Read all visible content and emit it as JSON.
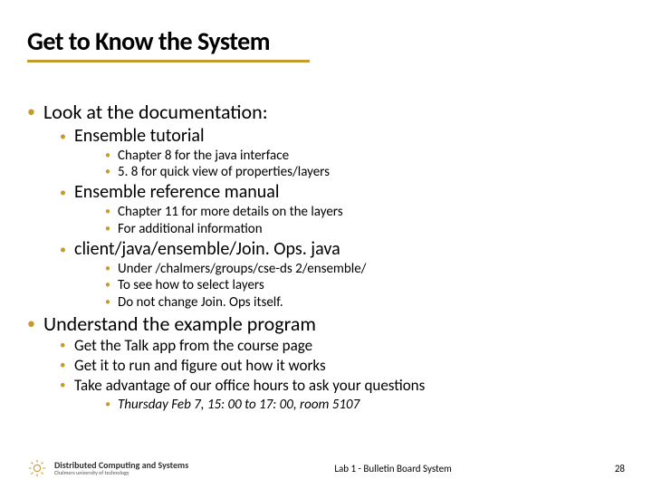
{
  "title": "Get to Know the System",
  "bullets": {
    "l1_doc": "Look at the documentation:",
    "l2_tutorial": "Ensemble tutorial",
    "l3_ch8": "Chapter 8 for the java interface",
    "l3_58": "5. 8 for quick view of properties/layers",
    "l2_refman": "Ensemble reference manual",
    "l3_ch11": "Chapter 11 for more details on the layers",
    "l3_addl": "For additional information",
    "l2_joinops": "client/java/ensemble/Join. Ops. java",
    "l3_under": "Under /chalmers/groups/cse-ds 2/ensemble/",
    "l3_select": "To see how to select layers",
    "l3_nochange": "Do not change Join. Ops itself.",
    "l1_understand": "Understand the example program",
    "l2_talk": "Get the Talk app from the course page",
    "l2_run": "Get it to run and figure out how it works",
    "l2_office": "Take advantage of our office hours to ask your questions",
    "l3_italic": "Thursday Feb 7, 15: 00 to 17: 00, room 5107"
  },
  "footer": {
    "logo_main": "Distributed Computing and Systems",
    "logo_sub": "Chalmers university of technology",
    "lab": "Lab 1 - Bulletin Board System",
    "page": "28"
  }
}
